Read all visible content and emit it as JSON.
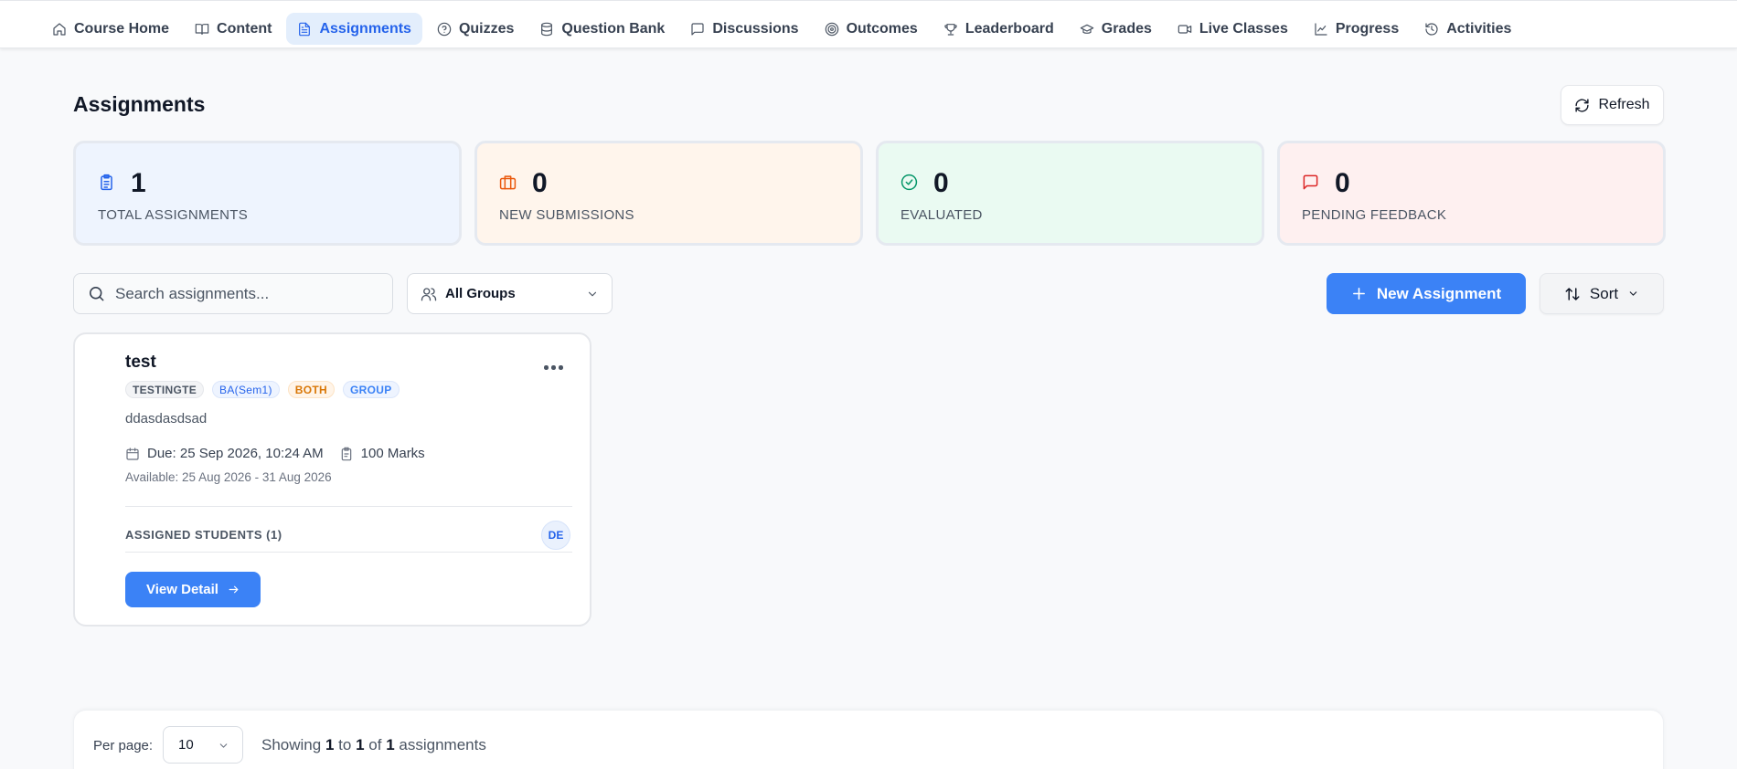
{
  "nav": {
    "items": [
      {
        "label": "Course Home",
        "icon": "home-icon"
      },
      {
        "label": "Content",
        "icon": "book-icon"
      },
      {
        "label": "Assignments",
        "icon": "file-text-icon",
        "active": true
      },
      {
        "label": "Quizzes",
        "icon": "help-circle-icon"
      },
      {
        "label": "Question Bank",
        "icon": "database-icon"
      },
      {
        "label": "Discussions",
        "icon": "message-square-icon"
      },
      {
        "label": "Outcomes",
        "icon": "target-icon"
      },
      {
        "label": "Leaderboard",
        "icon": "trophy-icon"
      },
      {
        "label": "Grades",
        "icon": "graduation-cap-icon"
      },
      {
        "label": "Live Classes",
        "icon": "video-icon"
      },
      {
        "label": "Progress",
        "icon": "line-chart-icon"
      },
      {
        "label": "Activities",
        "icon": "history-icon"
      }
    ]
  },
  "page": {
    "title": "Assignments",
    "refresh_label": "Refresh"
  },
  "stats": [
    {
      "value": "1",
      "label": "TOTAL ASSIGNMENTS",
      "icon": "clipboard-list-icon",
      "bg": "#eef4fe",
      "color": "#2563eb"
    },
    {
      "value": "0",
      "label": "NEW SUBMISSIONS",
      "icon": "briefcase-icon",
      "bg": "#fff5ec",
      "color": "#ea580c"
    },
    {
      "value": "0",
      "label": "EVALUATED",
      "icon": "check-circle-icon",
      "bg": "#eafaf2",
      "color": "#059669"
    },
    {
      "value": "0",
      "label": "PENDING FEEDBACK",
      "icon": "message-square-icon",
      "bg": "#fef0f0",
      "color": "#dc2626"
    }
  ],
  "toolbar": {
    "search_placeholder": "Search assignments...",
    "groups_label": "All Groups",
    "new_label": "New Assignment",
    "sort_label": "Sort"
  },
  "assignments": [
    {
      "title": "test",
      "tags": [
        "TESTINGTE",
        "BA(Sem1)",
        "BOTH",
        "GROUP"
      ],
      "description": "ddasdasdsad",
      "due": "Due: 25 Sep 2026, 10:24 AM",
      "marks": "100 Marks",
      "available": "Available: 25 Aug 2026 - 31 Aug 2026",
      "assigned_label": "ASSIGNED STUDENTS (1)",
      "avatar_initials": "DE",
      "view_label": "View Detail"
    }
  ],
  "footer": {
    "per_page_label": "Per page:",
    "per_page_value": "10",
    "showing_prefix": "Showing",
    "from": "1",
    "to_word": "to",
    "to": "1",
    "of_word": "of",
    "total": "1",
    "suffix": "assignments"
  }
}
